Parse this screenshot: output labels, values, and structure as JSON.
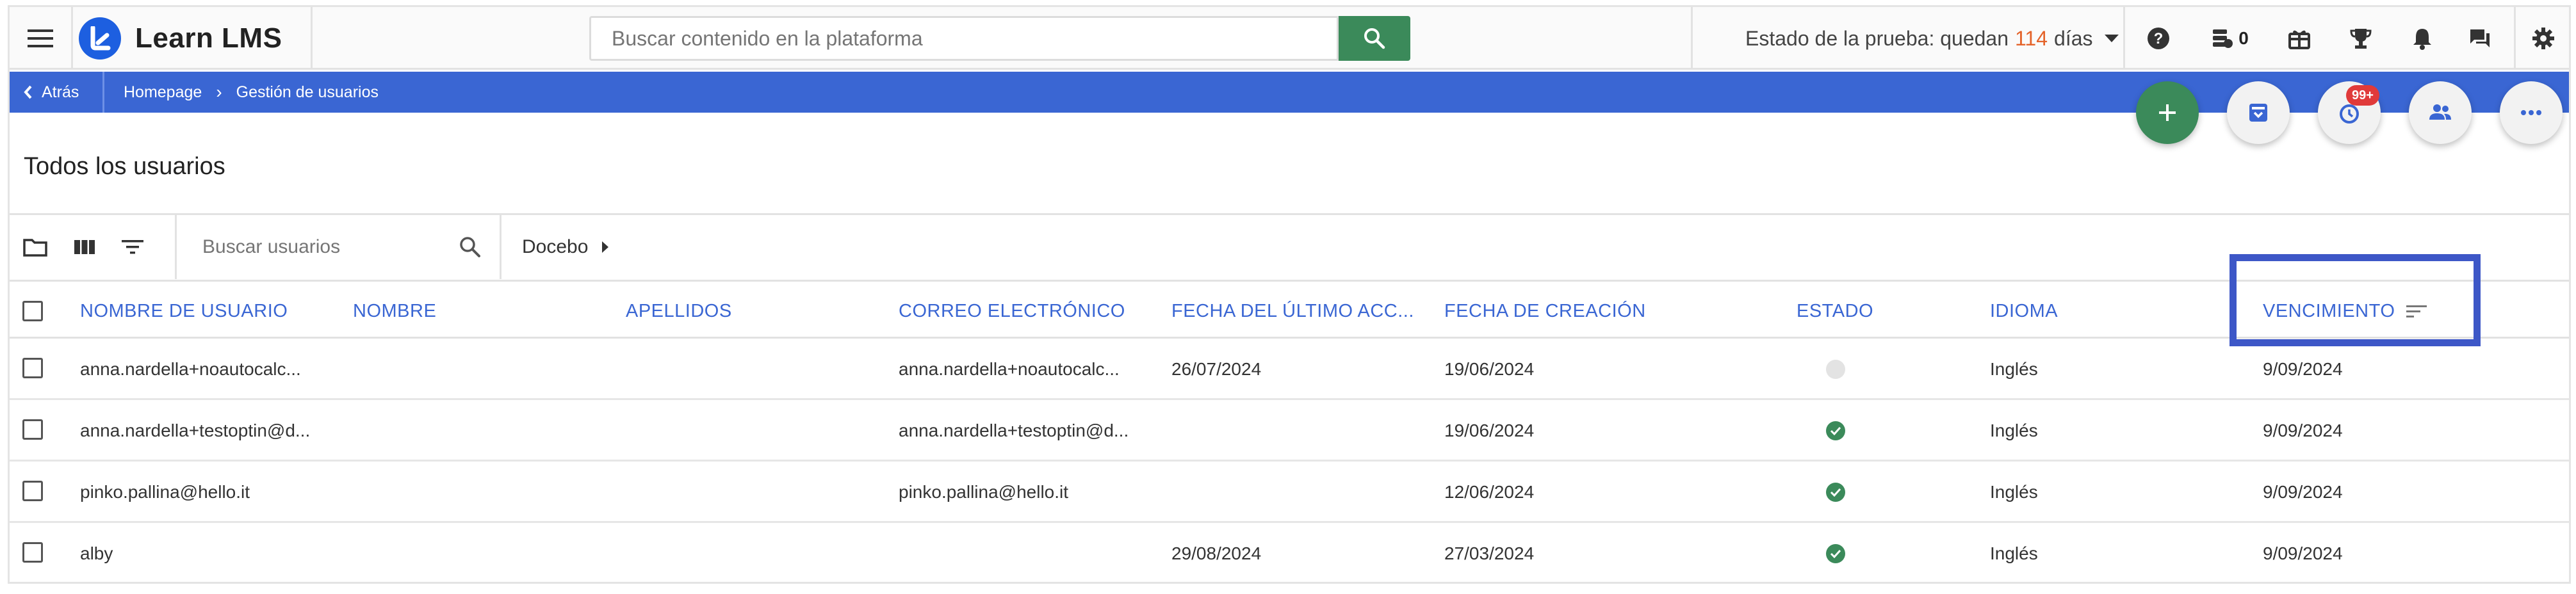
{
  "header": {
    "brand": "Learn LMS",
    "search_placeholder": "Buscar contenido en la plataforma",
    "trial_prefix": "Estado de la prueba: quedan",
    "trial_days": "114",
    "trial_suffix": "días",
    "credits_count": "0"
  },
  "breadcrumb": {
    "back_label": "Atrás",
    "items": [
      "Homepage",
      "Gestión de usuarios"
    ],
    "separator": "›"
  },
  "fabs": {
    "notification_badge": "99+"
  },
  "page": {
    "title": "Todos los usuarios"
  },
  "toolbar": {
    "search_placeholder": "Buscar usuarios",
    "branch": "Docebo"
  },
  "table": {
    "columns": [
      "NOMBRE DE USUARIO",
      "NOMBRE",
      "APELLIDOS",
      "CORREO ELECTRÓNICO",
      "FECHA DEL ÚLTIMO ACC...",
      "FECHA DE CREACIÓN",
      "ESTADO",
      "IDIOMA",
      "VENCIMIENTO"
    ],
    "rows": [
      {
        "username": "anna.nardella+noautocalc...",
        "first": "",
        "last": "",
        "email": "anna.nardella+noautocalc...",
        "last_access": "26/07/2024",
        "created": "19/06/2024",
        "status": "inactive",
        "language": "Inglés",
        "expiry": "9/09/2024"
      },
      {
        "username": "anna.nardella+testoptin@d...",
        "first": "",
        "last": "",
        "email": "anna.nardella+testoptin@d...",
        "last_access": "",
        "created": "19/06/2024",
        "status": "active",
        "language": "Inglés",
        "expiry": "9/09/2024"
      },
      {
        "username": "pinko.pallina@hello.it",
        "first": "",
        "last": "",
        "email": "pinko.pallina@hello.it",
        "last_access": "",
        "created": "12/06/2024",
        "status": "active",
        "language": "Inglés",
        "expiry": "9/09/2024"
      },
      {
        "username": "alby",
        "first": "",
        "last": "",
        "email": "",
        "last_access": "29/08/2024",
        "created": "27/03/2024",
        "status": "active",
        "language": "Inglés",
        "expiry": "9/09/2024"
      }
    ]
  },
  "colors": {
    "accent_blue": "#3a66d3",
    "green": "#3b8a5a",
    "trial_orange": "#e4632a",
    "badge_red": "#e03a3a",
    "highlight": "#3d57c7"
  }
}
